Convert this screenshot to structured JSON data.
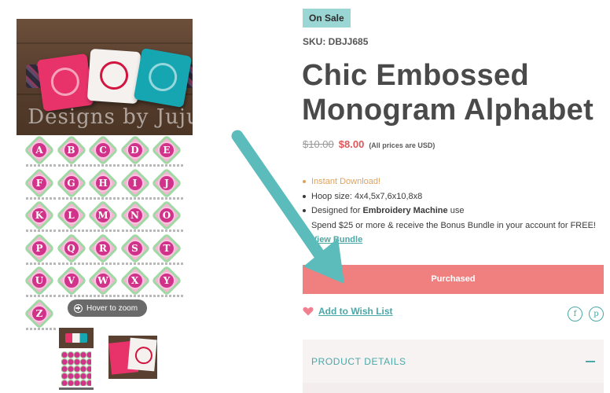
{
  "gallery": {
    "watermark": "Designs by Juju",
    "letters": [
      "A",
      "B",
      "C",
      "D",
      "E",
      "F",
      "G",
      "H",
      "I",
      "J",
      "K",
      "L",
      "M",
      "N",
      "O",
      "P",
      "Q",
      "R",
      "S",
      "T",
      "U",
      "V",
      "W",
      "X",
      "Y",
      "Z"
    ],
    "zoom_label": "Hover to zoom",
    "zoom_icon": "zoom-plus-icon"
  },
  "product": {
    "badge": "On Sale",
    "sku": "SKU: DBJJ685",
    "title": "Chic Embossed Monogram Alphabet",
    "old_price": "$10.00",
    "new_price": "$8.00",
    "price_note": "(All prices are USD)",
    "features": {
      "instant": "Instant Download!",
      "hoop": "Hoop size: 4x4,5x7,6x10,8x8",
      "designed_prefix": "Designed for ",
      "designed_bold": "Embroidery Machine",
      "designed_suffix": " use",
      "bundle_offer": "Spend $25 or more & receive the Bonus Bundle in your account for FREE!",
      "view_bundle": "View Bundle"
    },
    "purchase_button": "Purchased",
    "wishlist": "Add to Wish List",
    "share_facebook": "f",
    "share_pinterest": "p",
    "details_header": "PRODUCT DETAILS"
  },
  "colors": {
    "accent": "#4aa8a6",
    "sale_badge": "#9ad6d4",
    "sale_price": "#e0575b",
    "button": "#f08080",
    "arrow": "#5bbcbb"
  }
}
